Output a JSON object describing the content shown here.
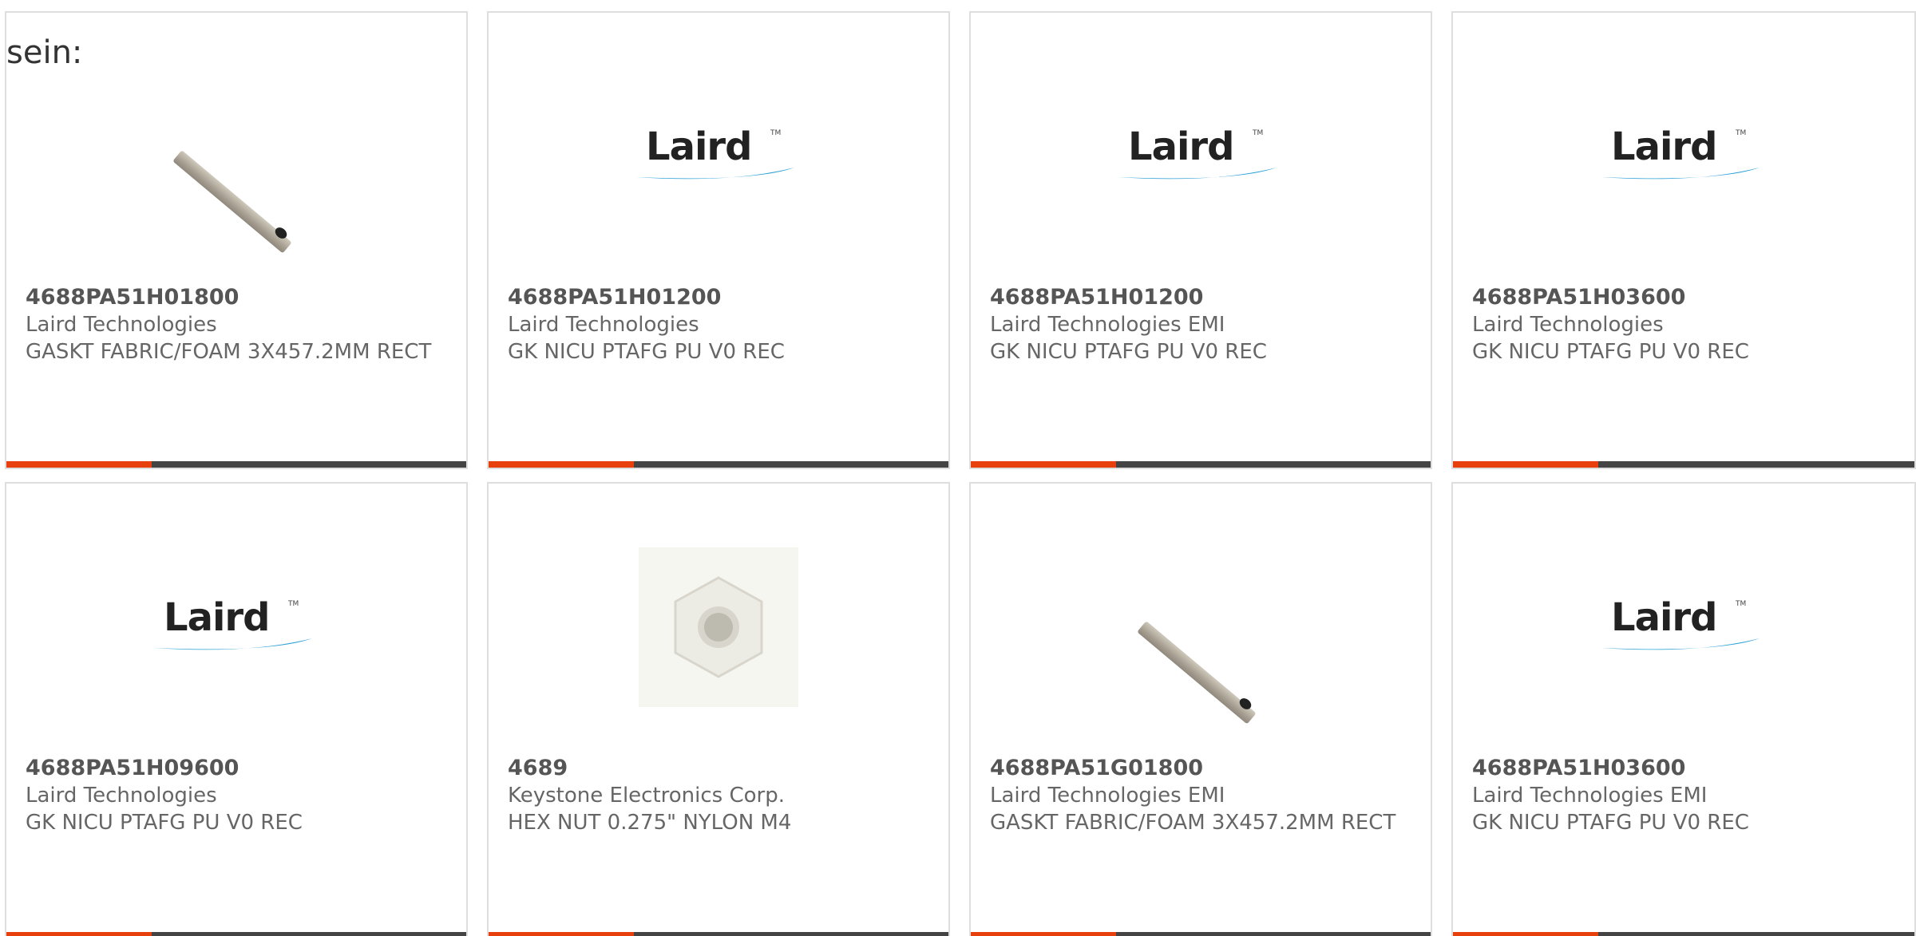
{
  "intro_text": "sein:",
  "brand_logo": "Laird",
  "colors": {
    "accent": "#e8400c",
    "bar": "#444444",
    "border": "#dedede"
  },
  "products": [
    {
      "part": "4688PA51H01800",
      "maker": "Laird Technologies",
      "desc": "GASKT FABRIC/FOAM 3X457.2MM RECT",
      "image": "gasket-strip"
    },
    {
      "part": "4688PA51H01200",
      "maker": "Laird Technologies",
      "desc": "GK NICU PTAFG PU V0 REC",
      "image": "laird-logo"
    },
    {
      "part": "4688PA51H01200",
      "maker": "Laird Technologies EMI",
      "desc": "GK NICU PTAFG PU V0 REC",
      "image": "laird-logo"
    },
    {
      "part": "4688PA51H03600",
      "maker": "Laird Technologies",
      "desc": "GK NICU PTAFG PU V0 REC",
      "image": "laird-logo"
    },
    {
      "part": "4688PA51H09600",
      "maker": "Laird Technologies",
      "desc": "GK NICU PTAFG PU V0 REC",
      "image": "laird-logo"
    },
    {
      "part": "4689",
      "maker": "Keystone Electronics Corp.",
      "desc": "HEX NUT 0.275\" NYLON M4",
      "image": "hex-nut"
    },
    {
      "part": "4688PA51G01800",
      "maker": "Laird Technologies EMI",
      "desc": "GASKT FABRIC/FOAM 3X457.2MM RECT",
      "image": "gasket-strip"
    },
    {
      "part": "4688PA51H03600",
      "maker": "Laird Technologies EMI",
      "desc": "GK NICU PTAFG PU V0 REC",
      "image": "laird-logo"
    }
  ]
}
